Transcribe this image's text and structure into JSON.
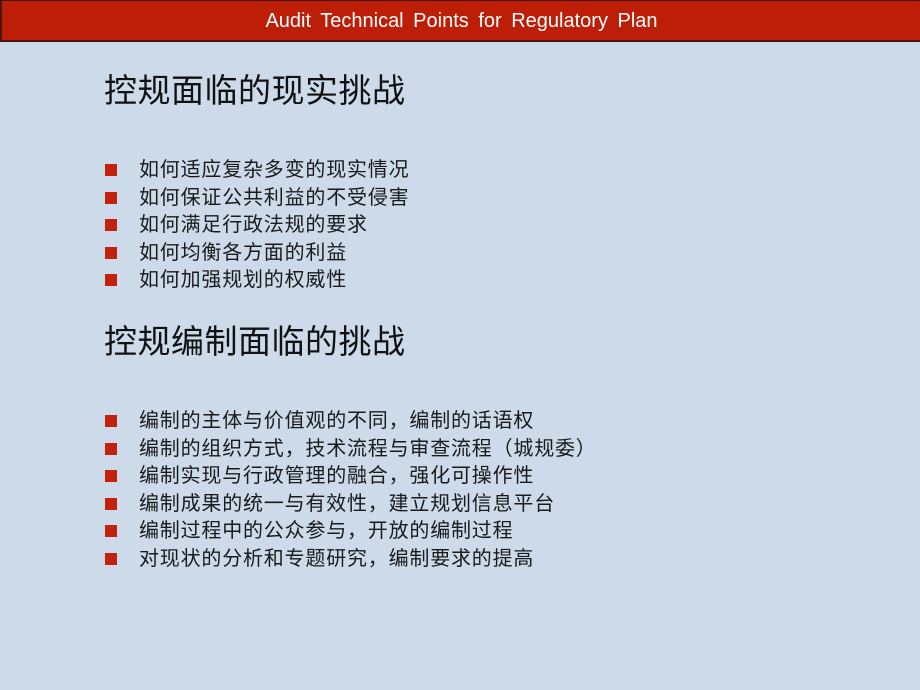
{
  "header": {
    "title": "Audit  Technical Points for  Regulatory  Plan",
    "background_color": "#BC1E08",
    "text_color": "#FFFFFF"
  },
  "theme": {
    "page_background": "#CCDAEA",
    "bullet_color": "#C4200E",
    "bullet_icon": "square-bullet-icon"
  },
  "sections": [
    {
      "heading": "控规面临的现实挑战",
      "items": [
        "如何适应复杂多变的现实情况",
        "如何保证公共利益的不受侵害",
        "如何满足行政法规的要求",
        "如何均衡各方面的利益",
        "如何加强规划的权威性"
      ]
    },
    {
      "heading": "控规编制面临的挑战",
      "items": [
        "编制的主体与价值观的不同，编制的话语权",
        "编制的组织方式，技术流程与审查流程（城规委）",
        "编制实现与行政管理的融合，强化可操作性",
        "编制成果的统一与有效性，建立规划信息平台",
        "编制过程中的公众参与，开放的编制过程",
        "对现状的分析和专题研究，编制要求的提高"
      ]
    }
  ]
}
